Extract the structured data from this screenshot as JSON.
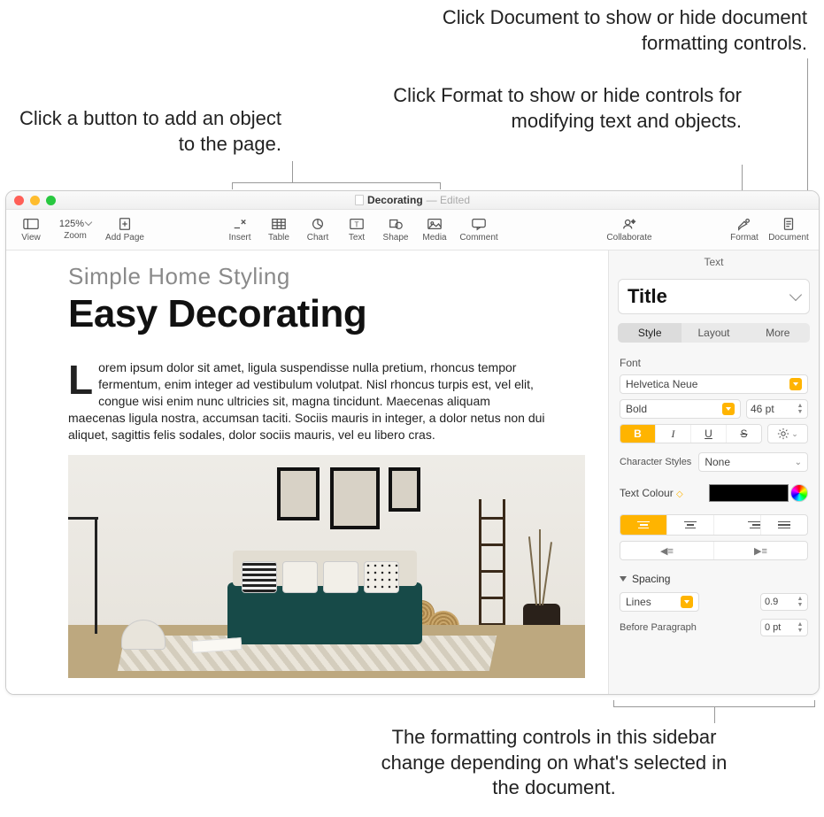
{
  "callouts": {
    "add_object": "Click a button to add an object to the page.",
    "format": "Click Format to show or hide controls for modifying text and objects.",
    "document": "Click Document to show or hide document formatting controls.",
    "sidebar": "The formatting controls in this sidebar change depending on what's selected in the document."
  },
  "titlebar": {
    "name": "Decorating",
    "status": "— Edited"
  },
  "toolbar": {
    "view": "View",
    "zoom": "Zoom",
    "zoom_value": "125%",
    "add_page": "Add Page",
    "insert": "Insert",
    "table": "Table",
    "chart": "Chart",
    "text": "Text",
    "shape": "Shape",
    "media": "Media",
    "comment": "Comment",
    "collaborate": "Collaborate",
    "format": "Format",
    "document": "Document"
  },
  "doc": {
    "subhead": "Simple Home Styling",
    "headline": "Easy Decorating",
    "dropcap": "L",
    "body": "orem ipsum dolor sit amet, ligula suspendisse nulla pretium, rhoncus tempor fermentum, enim integer ad vestibulum volutpat. Nisl rhoncus turpis est, vel elit, congue wisi enim nunc ultricies sit, magna tincidunt. Maecenas aliquam maecenas ligula nostra, accumsan taciti. Sociis mauris in integer, a dolor netus non dui aliquet, sagittis felis sodales, dolor sociis mauris, vel eu libero cras."
  },
  "sidebar": {
    "header": "Text",
    "style_name": "Title",
    "tabs": {
      "style": "Style",
      "layout": "Layout",
      "more": "More"
    },
    "font_label": "Font",
    "font_family": "Helvetica Neue",
    "font_weight": "Bold",
    "font_size": "46 pt",
    "b": "B",
    "i": "I",
    "u": "U",
    "s": "S",
    "char_styles_label": "Character Styles",
    "char_styles_value": "None",
    "text_colour_label": "Text Colour",
    "spacing_label": "Spacing",
    "lines_label": "Lines",
    "lines_value": "0.9",
    "before_label": "Before Paragraph",
    "before_value": "0 pt"
  }
}
